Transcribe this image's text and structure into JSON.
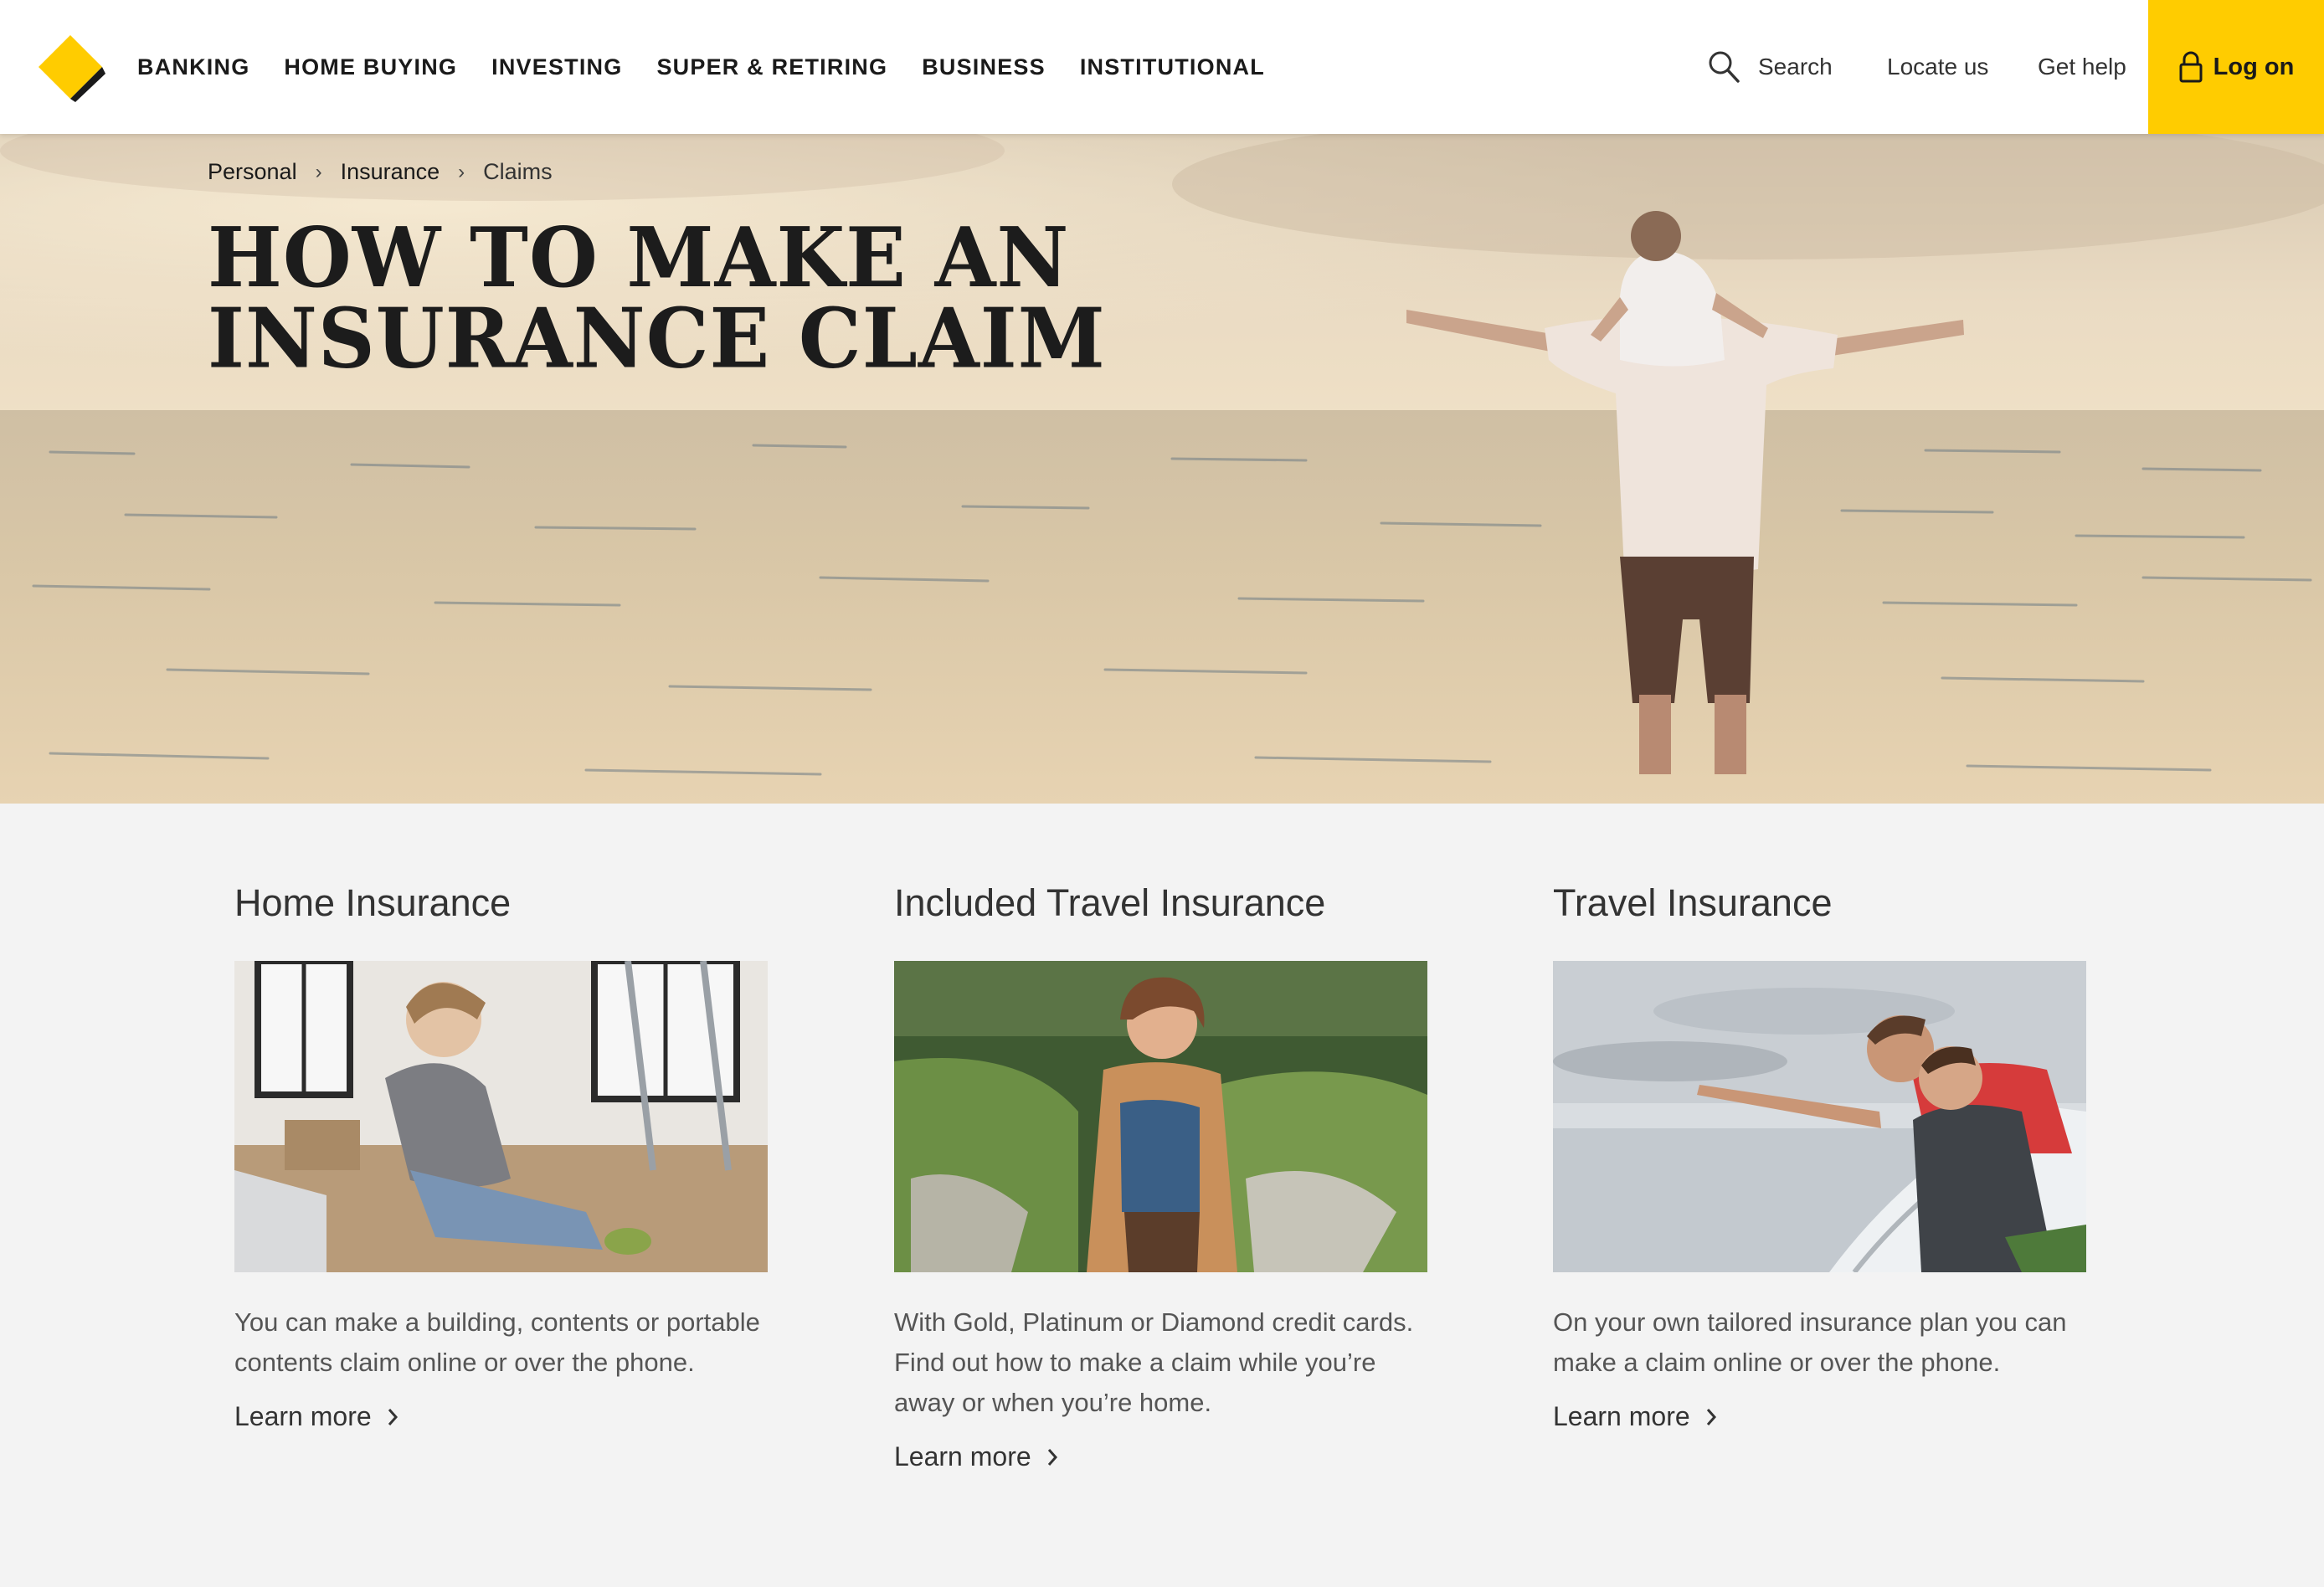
{
  "header": {
    "nav": [
      "BANKING",
      "HOME BUYING",
      "INVESTING",
      "SUPER & RETIRING",
      "BUSINESS",
      "INSTITUTIONAL"
    ],
    "search_label": "Search",
    "locate_label": "Locate us",
    "help_label": "Get help",
    "logon_label": "Log on",
    "brand_color": "#ffcc00"
  },
  "hero": {
    "breadcrumb": [
      "Personal",
      "Insurance",
      "Claims"
    ],
    "title_line1": "HOW TO MAKE AN",
    "title_line2": "INSURANCE CLAIM"
  },
  "cards": [
    {
      "title": "Home Insurance",
      "description": "You can make a building, contents or portable contents claim online or over the phone.",
      "link": "Learn more"
    },
    {
      "title": "Included Travel Insurance",
      "description": "With Gold, Platinum or Diamond credit cards. Find out how to make a claim while you’re away or when you’re home.",
      "link": "Learn more"
    },
    {
      "title": "Travel Insurance",
      "description": "On your own tailored insurance plan you can make a claim online or over the phone.",
      "link": "Learn more"
    }
  ]
}
